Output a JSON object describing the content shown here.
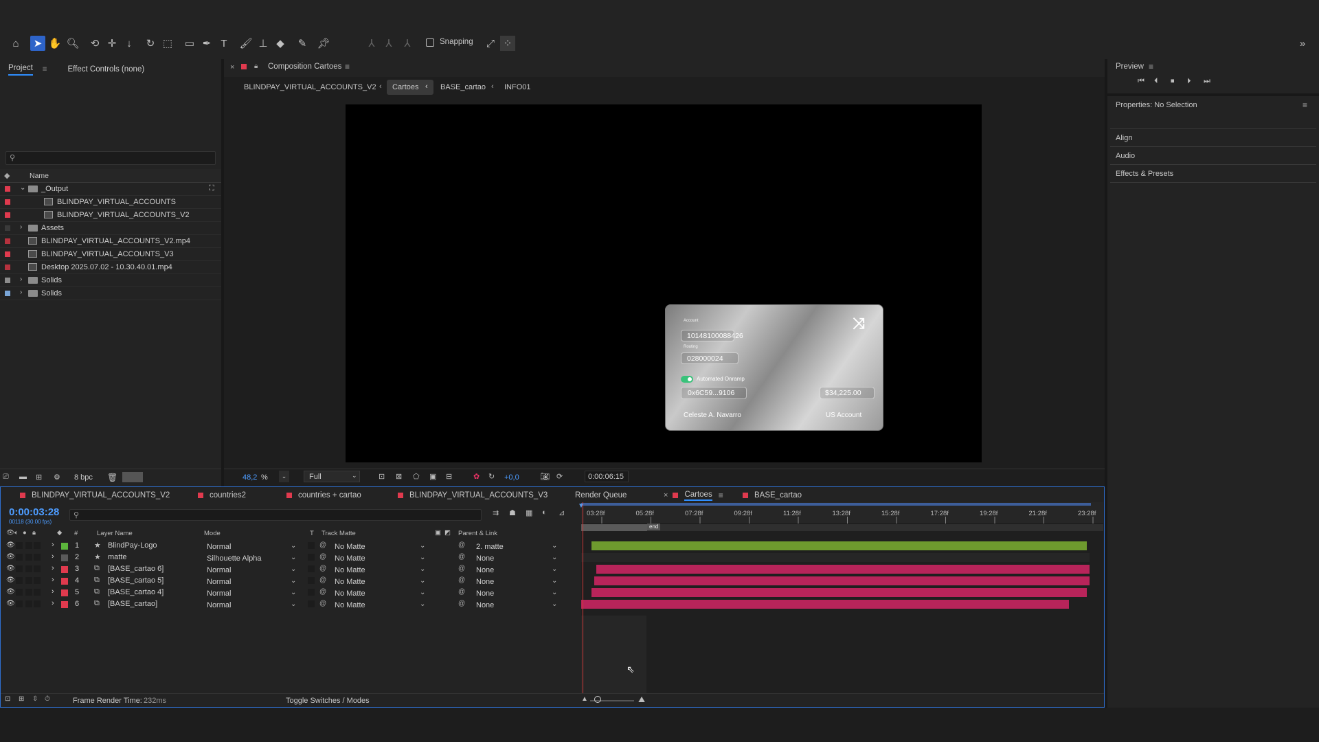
{
  "toolbar": {
    "snapping_label": "Snapping",
    "tools": [
      "home-icon",
      "selection-arrow-icon",
      "hand-icon",
      "zoom-icon",
      "orbit-icon",
      "pan-icon",
      "dolly-icon",
      "rotate-icon",
      "pan-behind-icon",
      "rectangle-icon",
      "pen-icon",
      "type-icon",
      "brush-icon",
      "clone-stamp-icon",
      "eraser-icon",
      "roto-brush-icon",
      "puppet-pin-icon"
    ]
  },
  "project_panel": {
    "tab_project": "Project",
    "tab_effect_controls": "Effect Controls (none)",
    "search_placeholder": "",
    "col_name": "Name",
    "bpc": "8 bpc",
    "items": [
      {
        "label": "_Output",
        "type": "folder",
        "color": "#e03a4e",
        "depth": 0,
        "expanded": true
      },
      {
        "label": "BLINDPAY_VIRTUAL_ACCOUNTS",
        "type": "comp",
        "color": "#e03a4e",
        "depth": 1
      },
      {
        "label": "BLINDPAY_VIRTUAL_ACCOUNTS_V2",
        "type": "comp",
        "color": "#e03a4e",
        "depth": 1
      },
      {
        "label": "Assets",
        "type": "folder",
        "color": "#3a3a3a",
        "depth": 0
      },
      {
        "label": "BLINDPAY_VIRTUAL_ACCOUNTS_V2.mp4",
        "type": "footage",
        "color": "#b6323e",
        "depth": 0
      },
      {
        "label": "BLINDPAY_VIRTUAL_ACCOUNTS_V3",
        "type": "comp",
        "color": "#e03a4e",
        "depth": 0
      },
      {
        "label": "Desktop 2025.07.02 - 10.30.40.01.mp4",
        "type": "footage",
        "color": "#b6323e",
        "depth": 0
      },
      {
        "label": "Solids",
        "type": "folder",
        "color": "#8c8c8c",
        "depth": 0
      },
      {
        "label": "Solids",
        "type": "folder",
        "color": "#7aa6d8",
        "depth": 0
      }
    ]
  },
  "composition_panel": {
    "title": "Composition Cartoes",
    "crumbs": [
      "BLINDPAY_VIRTUAL_ACCOUNTS_V2",
      "Cartoes",
      "BASE_cartao",
      "INFO01"
    ],
    "zoom": "48,2",
    "zoom_unit": "%",
    "resolution": "Full",
    "exposure": "+0,0",
    "timecode": "0:00:06:15"
  },
  "card": {
    "account_label": "Account",
    "account_value": "10148100088426",
    "routing_label": "Routing",
    "routing_value": "028000024",
    "toggle_label": "Automated Onramp",
    "wallet": "0x6C59...9106",
    "amount": "$34,225.00",
    "holder": "Celeste A. Navarro",
    "account_type": "US Account"
  },
  "preview_panel": {
    "title": "Preview",
    "properties_title": "Properties: No Selection",
    "sections": [
      "Align",
      "Audio",
      "Effects & Presets"
    ]
  },
  "timeline": {
    "tabs": [
      {
        "label": "BLINDPAY_VIRTUAL_ACCOUNTS_V2",
        "color": "#e03a4e"
      },
      {
        "label": "countries2",
        "color": "#e03a4e"
      },
      {
        "label": "countries + cartao",
        "color": "#e03a4e"
      },
      {
        "label": "BLINDPAY_VIRTUAL_ACCOUNTS_V3",
        "color": "#e03a4e"
      },
      {
        "label": "Render Queue",
        "color": ""
      },
      {
        "label": "Cartoes",
        "color": "#e03a4e",
        "active": true
      },
      {
        "label": "BASE_cartao",
        "color": "#e03a4e"
      }
    ],
    "timecode": "0:00:03:28",
    "fps": "00118 (30.00 fps)",
    "col_layer_name": "Layer Name",
    "col_mode": "Mode",
    "col_t": "T",
    "col_track_matte": "Track Matte",
    "col_parent": "Parent & Link",
    "col_num": "#",
    "ruler": [
      "03:28f",
      "05:28f",
      "07:28f",
      "09:28f",
      "11:28f",
      "13:28f",
      "15:28f",
      "17:28f",
      "19:28f",
      "21:28f",
      "23:28f"
    ],
    "marker_label": "end",
    "layers": [
      {
        "num": "1",
        "name": "BlindPay-Logo",
        "kind": "star",
        "color": "#5cb63c",
        "mode": "Normal",
        "matte": "No Matte",
        "parent": "2. matte",
        "bar_color": "#6e9a2e",
        "bar_start": 0.02,
        "bar_end": 0.995
      },
      {
        "num": "2",
        "name": "matte",
        "kind": "star",
        "color": "#5a5a5a",
        "mode": "Silhouette Alpha",
        "matte": "No Matte",
        "parent": "None",
        "bar_color": "",
        "bar_start": 0,
        "bar_end": 0
      },
      {
        "num": "3",
        "name": "[BASE_cartao 6]",
        "kind": "comp",
        "color": "#e03a4e",
        "mode": "Normal",
        "matte": "No Matte",
        "parent": "None",
        "bar_color": "#b8245a",
        "bar_start": 0.03,
        "bar_end": 1.0
      },
      {
        "num": "4",
        "name": "[BASE_cartao 5]",
        "kind": "comp",
        "color": "#e03a4e",
        "mode": "Normal",
        "matte": "No Matte",
        "parent": "None",
        "bar_color": "#b8245a",
        "bar_start": 0.025,
        "bar_end": 1.0
      },
      {
        "num": "5",
        "name": "[BASE_cartao 4]",
        "kind": "comp",
        "color": "#e03a4e",
        "mode": "Normal",
        "matte": "No Matte",
        "parent": "None",
        "bar_color": "#b8245a",
        "bar_start": 0.02,
        "bar_end": 0.995
      },
      {
        "num": "6",
        "name": "[BASE_cartao]",
        "kind": "comp",
        "color": "#e03a4e",
        "mode": "Normal",
        "matte": "No Matte",
        "parent": "None",
        "bar_color": "#b8245a",
        "bar_start": 0.0,
        "bar_end": 0.96
      }
    ],
    "footer_render_label": "Frame Render Time:",
    "footer_render_value": "232ms",
    "footer_toggle": "Toggle Switches / Modes"
  }
}
